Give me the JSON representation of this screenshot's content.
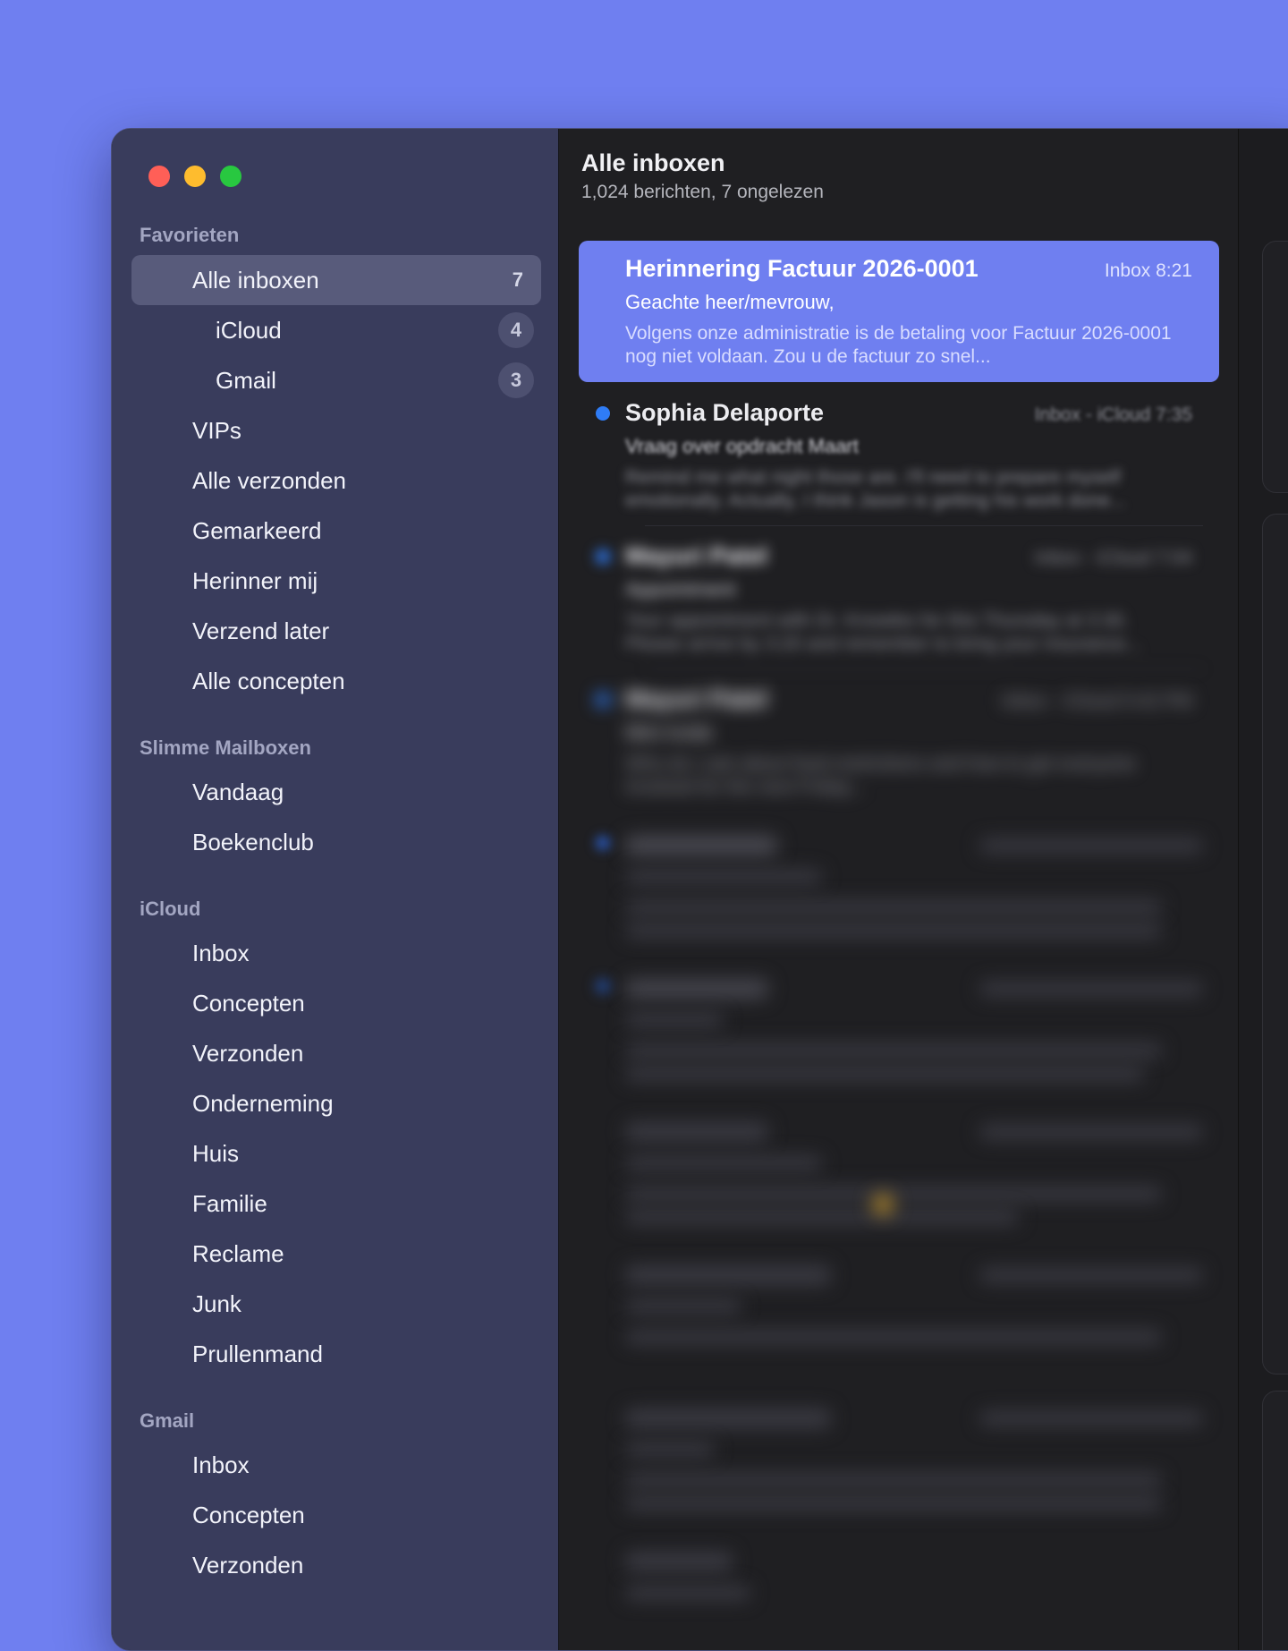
{
  "sidebar": {
    "window_controls": {
      "close_color": "#ff5f57",
      "minimize_color": "#febc2e",
      "zoom_color": "#28c840"
    },
    "sections": {
      "favorites": "Favorieten",
      "smart": "Slimme Mailboxen",
      "icloud": "iCloud",
      "gmail": "Gmail"
    },
    "favorites": [
      {
        "label": "Alle inboxen",
        "count": "7"
      },
      {
        "label": "iCloud",
        "count": "4"
      },
      {
        "label": "Gmail",
        "count": "3"
      },
      {
        "label": "VIPs"
      },
      {
        "label": "Alle verzonden"
      },
      {
        "label": "Gemarkeerd"
      },
      {
        "label": "Herinner mij"
      },
      {
        "label": "Verzend later"
      },
      {
        "label": "Alle concepten"
      }
    ],
    "smart": [
      {
        "label": "Vandaag"
      },
      {
        "label": "Boekenclub"
      }
    ],
    "icloud": [
      {
        "label": "Inbox"
      },
      {
        "label": "Concepten"
      },
      {
        "label": "Verzonden"
      },
      {
        "label": "Onderneming"
      },
      {
        "label": "Huis"
      },
      {
        "label": "Familie"
      },
      {
        "label": "Reclame"
      },
      {
        "label": "Junk"
      },
      {
        "label": "Prullenmand"
      }
    ],
    "gmail": [
      {
        "label": "Inbox"
      },
      {
        "label": "Concepten"
      },
      {
        "label": "Verzonden"
      }
    ]
  },
  "list": {
    "title": "Alle inboxen",
    "subtitle": "1,024 berichten, 7 ongelezen",
    "messages": [
      {
        "sender": "Herinnering Factuur 2026-0001",
        "meta": "Inbox  8:21",
        "subject": "Geachte heer/mevrouw,",
        "preview": "Volgens onze administratie is de betaling voor Factuur 2026-0001 nog niet voldaan. Zou u de factuur zo snel..."
      },
      {
        "sender": "Sophia Delaporte",
        "meta": "Inbox - iCloud  7:35",
        "subject": "Vraag over opdracht Maart",
        "preview": "Remind me what night those are. I'll need to prepare myself emotionally. Actually, I think Jason is getting his work done..."
      },
      {
        "sender": "Mayuri Patel",
        "meta": "Inbox - iCloud  7:04",
        "subject": "Appointment",
        "preview": "Your appointment with Dr. Knowles for this Thursday at 3:30. Please arrive by 3:20 and remember to bring your insurance..."
      },
      {
        "sender": "Mayuri Patel",
        "meta": "Inbox - iCloud  5:42 PM",
        "subject": "Mini invite",
        "preview": "Who do I ask about food restrictions and how to get everyone involved for the next Friday..."
      }
    ]
  }
}
